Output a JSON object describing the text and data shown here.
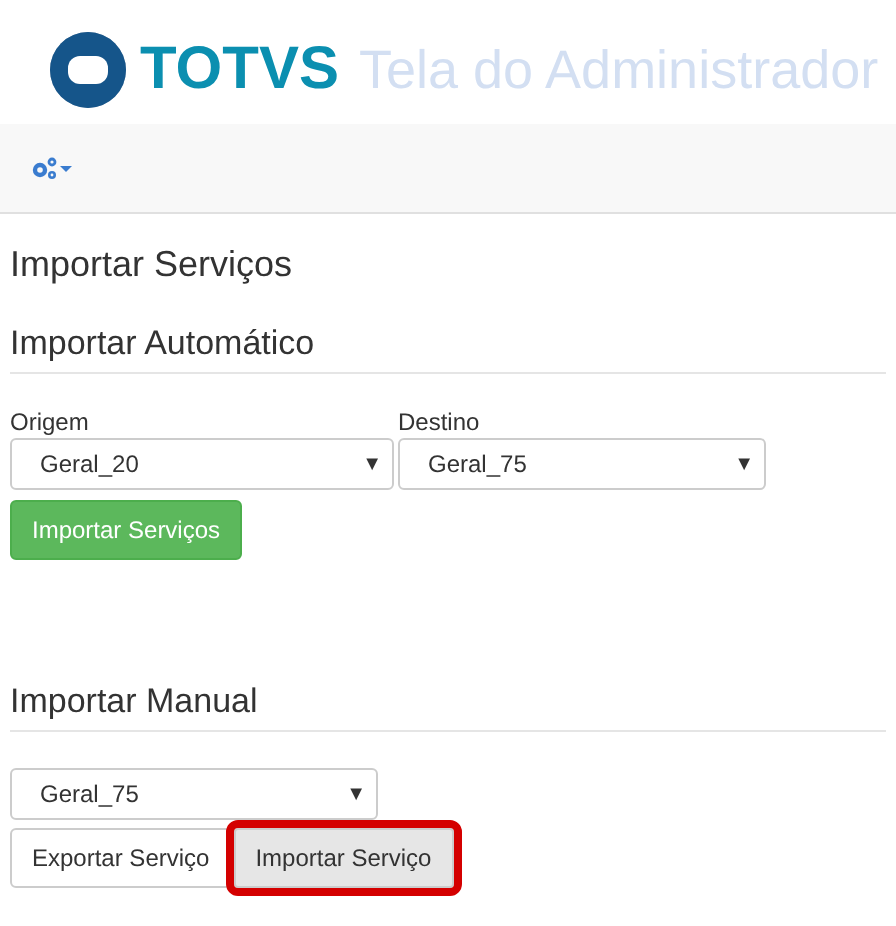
{
  "header": {
    "brand": "TOTVS",
    "title": "Tela do Administrador"
  },
  "page_title": "Importar Serviços",
  "automatic": {
    "heading": "Importar Automático",
    "fields": [
      {
        "label": "Origem",
        "value": "Geral_20",
        "arrow": "▼"
      },
      {
        "label": "Destino",
        "value": "Geral_75",
        "arrow": "▼"
      }
    ],
    "button": "Importar Serviços"
  },
  "manual": {
    "heading": "Importar Manual",
    "select": {
      "value": "Geral_75",
      "arrow": "▼"
    },
    "buttons": [
      {
        "label": "Exportar Serviço",
        "highlighted": false
      },
      {
        "label": "Importar Serviço",
        "highlighted": true
      }
    ]
  }
}
